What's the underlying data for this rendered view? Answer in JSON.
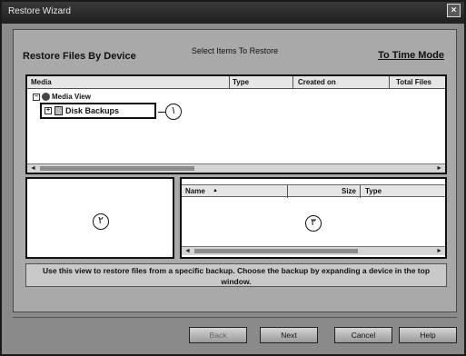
{
  "window": {
    "title": "Restore Wizard",
    "close_glyph": "×"
  },
  "wizard": {
    "header": "Select Items To Restore",
    "section_title": "Restore Files By Device",
    "mode_link": "To Time Mode"
  },
  "media_list": {
    "columns": [
      "Media",
      "Type",
      "Created on",
      "Total Files"
    ],
    "root": "Media View",
    "child": "Disk Backups",
    "callout": "١"
  },
  "left_pane": {
    "callout": "٢"
  },
  "right_pane": {
    "columns": [
      "Name",
      "Size",
      "Type"
    ],
    "sort_glyph": "▲",
    "callout": "٣"
  },
  "info_text": "Use this view to restore files from a specific backup. Choose the backup by expanding a device in the top window.",
  "buttons": {
    "back": "Back",
    "next": "Next",
    "cancel": "Cancel",
    "help": "Help"
  },
  "icons": [
    "close-icon",
    "collapse-icon",
    "expand-icon",
    "media-view-icon",
    "disk-backups-icon",
    "sort-ascending-icon",
    "scroll-left-icon",
    "scroll-right-icon"
  ]
}
